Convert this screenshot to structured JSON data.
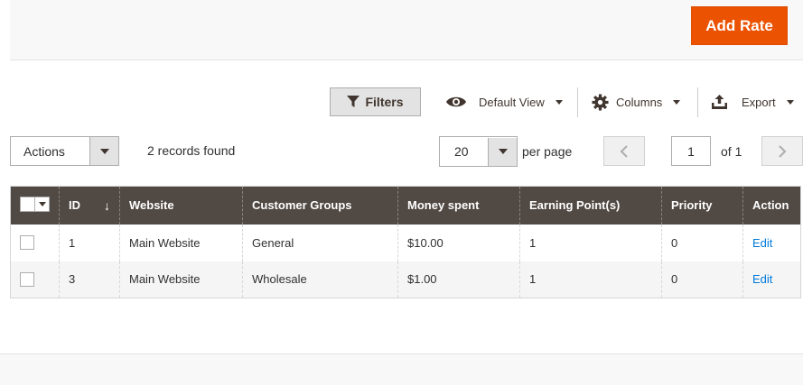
{
  "header": {
    "add_rate_label": "Add Rate"
  },
  "toolbar": {
    "filters_label": "Filters",
    "view_label": "Default View",
    "columns_label": "Columns",
    "export_label": "Export"
  },
  "grid_controls": {
    "actions_label": "Actions",
    "records_found": "2 records found",
    "per_page_value": "20",
    "per_page_label": "per page",
    "current_page": "1",
    "of_pages": "of 1"
  },
  "table": {
    "columns": [
      "ID",
      "Website",
      "Customer Groups",
      "Money spent",
      "Earning Point(s)",
      "Priority",
      "Action"
    ],
    "sort_indicator": "↓",
    "rows": [
      {
        "id": "1",
        "website": "Main Website",
        "customer_groups": "General",
        "money_spent": "$10.00",
        "earning_points": "1",
        "priority": "0",
        "action": "Edit"
      },
      {
        "id": "3",
        "website": "Main Website",
        "customer_groups": "Wholesale",
        "money_spent": "$1.00",
        "earning_points": "1",
        "priority": "0",
        "action": "Edit"
      }
    ]
  },
  "icons": {
    "filter": "funnel-icon",
    "view": "eye-icon",
    "columns": "gear-icon",
    "export": "upload-icon",
    "prev": "chevron-left-icon",
    "next": "chevron-right-icon"
  },
  "colors": {
    "accent": "#eb5202",
    "table_header": "#514943",
    "link": "#007bdb"
  }
}
